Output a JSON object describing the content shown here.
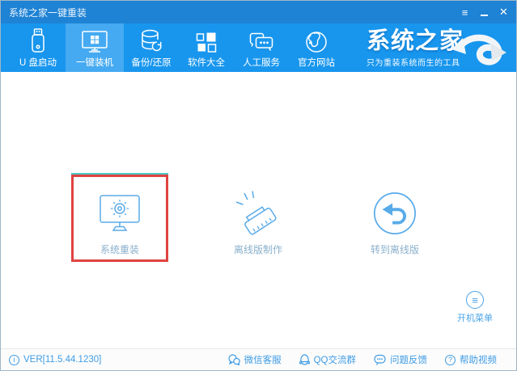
{
  "colors": {
    "titlebar": "#1e82d5",
    "navbar": "#1896ee",
    "nav_active_tile": "#45aaf2",
    "accent_blue": "#3e9ce5",
    "content_icon_blue": "#58abe9",
    "option_label_gray_blue": "#8ab0cc",
    "highlight_red": "#e04340"
  },
  "titlebar": {
    "title": "系统之家一键重装",
    "menu_glyph": "≡",
    "close_glyph": "✕"
  },
  "nav": {
    "items": [
      {
        "label": "U 盘启动",
        "icon": "usb-drive"
      },
      {
        "label": "一键装机",
        "icon": "monitor-windows",
        "active": true
      },
      {
        "label": "备份/还原",
        "icon": "database-restore"
      },
      {
        "label": "软件大全",
        "icon": "app-grid"
      },
      {
        "label": "人工服务",
        "icon": "chat-service"
      },
      {
        "label": "官方网站",
        "icon": "globe"
      }
    ],
    "logo": {
      "name": "系统之家",
      "tagline": "只为重装系统而生的工具"
    }
  },
  "main": {
    "options": [
      {
        "label": "系统重装",
        "icon": "monitor-gear",
        "highlighted": true
      },
      {
        "label": "离线版制作",
        "icon": "offline-plug"
      },
      {
        "label": "转到离线版",
        "icon": "back-arrow-circle"
      }
    ]
  },
  "boot_menu": {
    "label": "开机菜单",
    "glyph": "≡"
  },
  "statusbar": {
    "version": "VER[11.5.44.1230]",
    "info_glyph": "i",
    "links": [
      {
        "label": "微信客服",
        "icon": "wechat"
      },
      {
        "label": "QQ交流群",
        "icon": "qq"
      },
      {
        "label": "问题反馈",
        "icon": "feedback-bubble"
      },
      {
        "label": "帮助视频",
        "icon": "help-question",
        "glyph": "?"
      }
    ]
  }
}
